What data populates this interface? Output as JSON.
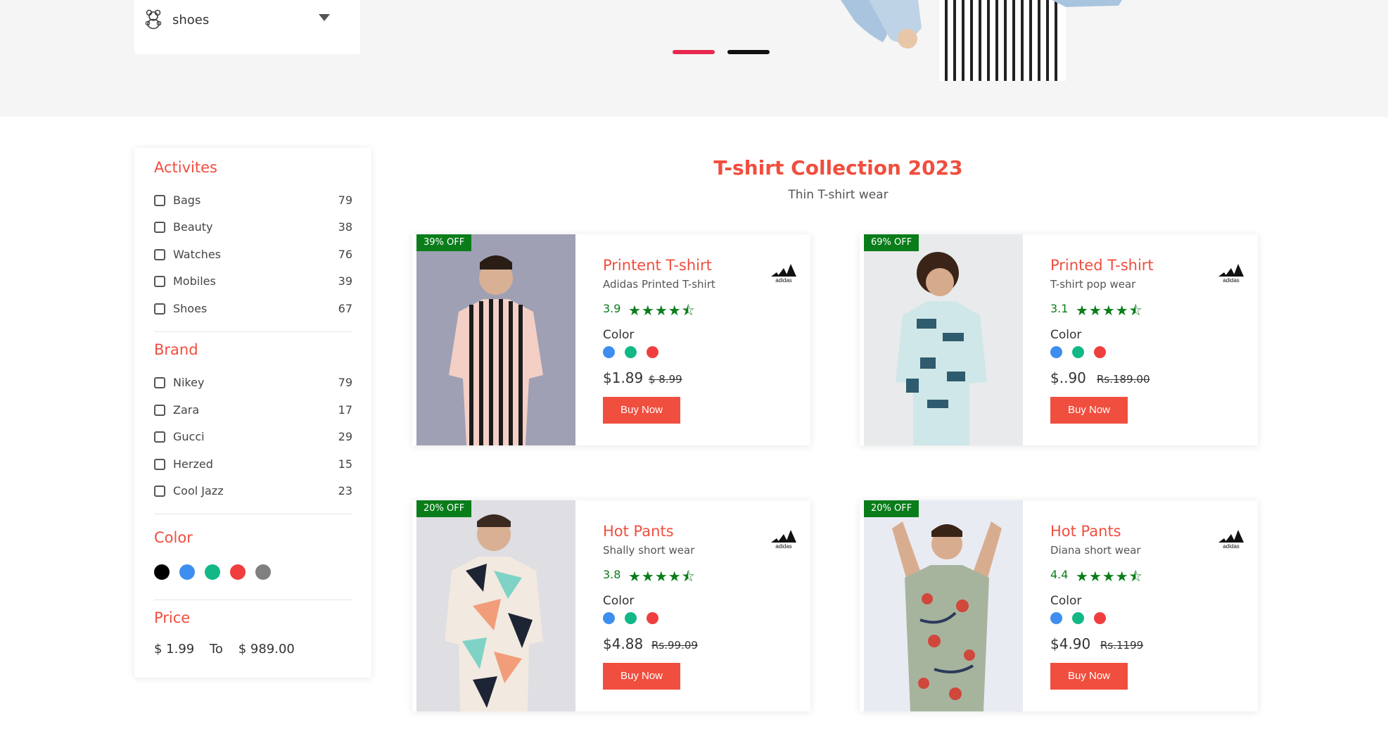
{
  "category": {
    "selected": "shoes"
  },
  "filters": {
    "activities": {
      "title": "Activites",
      "items": [
        {
          "label": "Bags",
          "count": "79"
        },
        {
          "label": "Beauty",
          "count": "38"
        },
        {
          "label": "Watches",
          "count": "76"
        },
        {
          "label": "Mobiles",
          "count": "39"
        },
        {
          "label": "Shoes",
          "count": "67"
        }
      ]
    },
    "brand": {
      "title": "Brand",
      "items": [
        {
          "label": "Nikey",
          "count": "79"
        },
        {
          "label": "Zara",
          "count": "17"
        },
        {
          "label": "Gucci",
          "count": "29"
        },
        {
          "label": "Herzed",
          "count": "15"
        },
        {
          "label": "Cool Jazz",
          "count": "23"
        }
      ]
    },
    "color": {
      "title": "Color",
      "swatches": [
        "#000000",
        "#3d8ef0",
        "#12b886",
        "#f03e3e",
        "#808080"
      ]
    },
    "price": {
      "title": "Price",
      "min": "$ 1.99",
      "to": "To",
      "max": "$ 989.00"
    }
  },
  "collection": {
    "title": "T-shirt Collection 2023",
    "subtitle": "Thin T-shirt wear"
  },
  "products": [
    {
      "badge": "39% OFF",
      "name": "Printent T-shirt",
      "desc": "Adidas Printed T-shirt",
      "rating": "3.9",
      "stars": "★★★★⯪",
      "color_label": "Color",
      "price": "$1.89",
      "old_price": "$ 8.99",
      "button": "Buy Now",
      "colors": [
        "#3d8ef0",
        "#12b886",
        "#f03e3e"
      ],
      "brand": "adidas-logo"
    },
    {
      "badge": "69% OFF",
      "name": "Printed T-shirt",
      "desc": "T-shirt pop wear",
      "rating": "3.1",
      "stars": "★★★★⯪",
      "color_label": "Color",
      "price": "$..90",
      "old_price": "Rs.189.00",
      "button": "Buy Now",
      "colors": [
        "#3d8ef0",
        "#12b886",
        "#f03e3e"
      ],
      "brand": "adidas-logo"
    },
    {
      "badge": "20% OFF",
      "name": "Hot Pants",
      "desc": "Shally short wear",
      "rating": "3.8",
      "stars": "★★★★⯪",
      "color_label": "Color",
      "price": "$4.88",
      "old_price": "Rs.99.09",
      "button": "Buy Now",
      "colors": [
        "#3d8ef0",
        "#12b886",
        "#f03e3e"
      ],
      "brand": "adidas-logo"
    },
    {
      "badge": "20% OFF",
      "name": "Hot Pants",
      "desc": "Diana short wear",
      "rating": "4.4",
      "stars": "★★★★⯪",
      "color_label": "Color",
      "price": "$4.90",
      "old_price": "Rs.1199",
      "button": "Buy Now",
      "colors": [
        "#3d8ef0",
        "#12b886",
        "#f03e3e"
      ],
      "brand": "adidas-logo"
    }
  ]
}
